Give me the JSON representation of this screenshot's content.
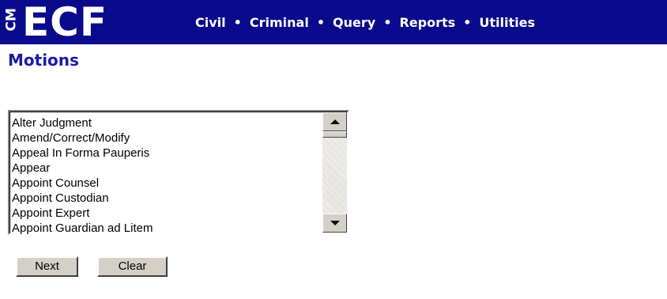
{
  "header": {
    "logo_cm": "CM",
    "logo_ecf": "ECF",
    "nav": [
      "Civil",
      "Criminal",
      "Query",
      "Reports",
      "Utilities"
    ],
    "separator": "•",
    "background_color": "#0a0a8c"
  },
  "page": {
    "title": "Motions",
    "title_color": "#1a1aa6"
  },
  "motions_list": {
    "items": [
      "Alter Judgment",
      "Amend/Correct/Modify",
      "Appeal In Forma Pauperis",
      "Appear",
      "Appoint Counsel",
      "Appoint Custodian",
      "Appoint Expert",
      "Appoint Guardian ad Litem"
    ],
    "scroll_up_icon": "triangle-up-icon",
    "scroll_down_icon": "triangle-down-icon"
  },
  "buttons": {
    "next_label": "Next",
    "clear_label": "Clear"
  }
}
